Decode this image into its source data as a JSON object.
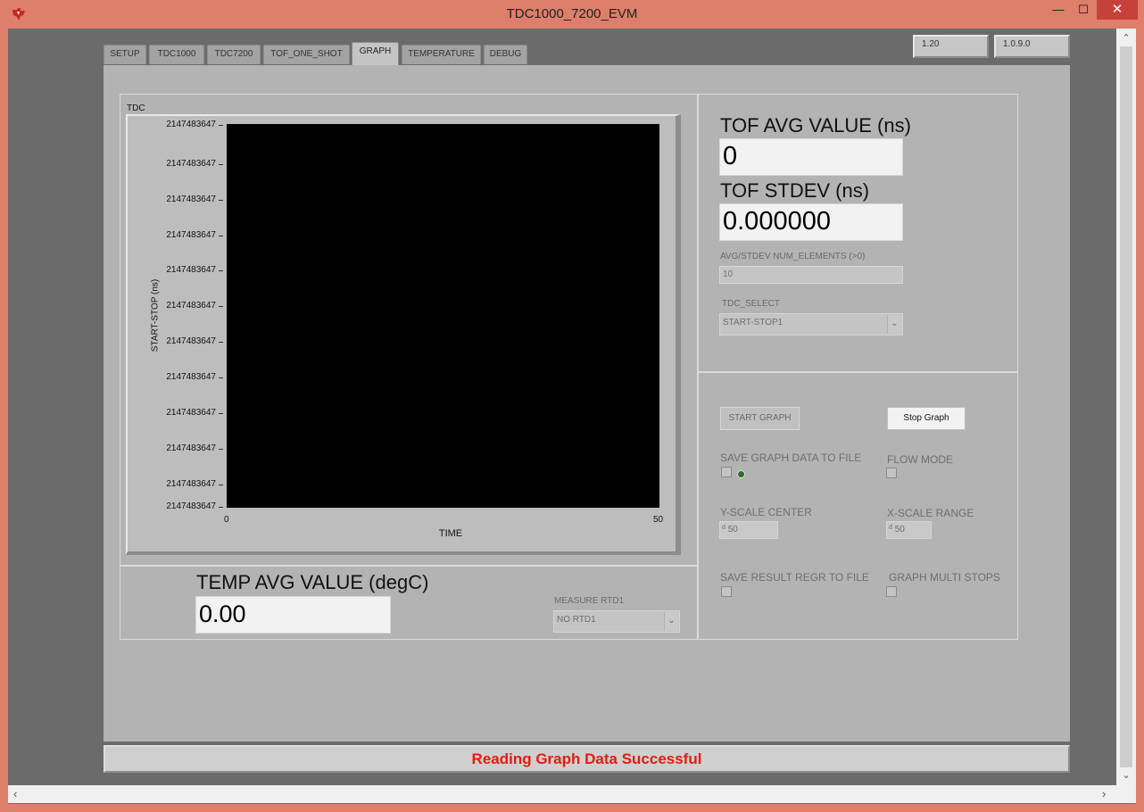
{
  "window": {
    "title": "TDC1000_7200_EVM"
  },
  "tabs": [
    {
      "label": "SETUP"
    },
    {
      "label": "TDC1000"
    },
    {
      "label": "TDC7200"
    },
    {
      "label": "TOF_ONE_SHOT"
    },
    {
      "label": "GRAPH",
      "active": true
    },
    {
      "label": "TEMPERATURE"
    },
    {
      "label": "DEBUG"
    }
  ],
  "versions": {
    "firmware": "1.20",
    "software": "1.0.9.0"
  },
  "graph": {
    "title": "TDC",
    "y_label": "START-STOP (ns)",
    "x_label": "TIME",
    "y_ticks": [
      "2147483647",
      "2147483647",
      "2147483647",
      "2147483647",
      "2147483647",
      "2147483647",
      "2147483647",
      "2147483647",
      "2147483647",
      "2147483647",
      "2147483647",
      "2147483647"
    ],
    "x_ticks": [
      "0",
      "50"
    ]
  },
  "chart_data": {
    "type": "line",
    "title": "TDC",
    "xlabel": "TIME",
    "ylabel": "START-STOP (ns)",
    "xlim": [
      0,
      50
    ],
    "series": []
  },
  "tof": {
    "avg_label": "TOF AVG VALUE (ns)",
    "avg_value": "0",
    "stdev_label": "TOF STDEV (ns)",
    "stdev_value": "0.000000",
    "num_elements_label": "AVG/STDEV NUM_ELEMENTS (>0)",
    "num_elements_value": "10",
    "tdc_select_label": "TDC_SELECT",
    "tdc_select_value": "START-STOP1"
  },
  "temp": {
    "avg_label": "TEMP AVG VALUE (degC)",
    "avg_value": "0.00",
    "measure_label": "MEASURE RTD1",
    "measure_value": "NO RTD1"
  },
  "controls": {
    "start_graph": "START GRAPH",
    "stop_graph": "Stop Graph",
    "save_graph_label": "SAVE GRAPH DATA TO FILE",
    "flow_mode_label": "FLOW MODE",
    "y_scale_center_label": "Y-SCALE CENTER",
    "y_scale_center_prefix": "d",
    "y_scale_center_value": "50",
    "x_scale_range_label": "X-SCALE RANGE",
    "x_scale_range_prefix": "d",
    "x_scale_range_value": "50",
    "save_result_label": "SAVE RESULT REGR TO FILE",
    "graph_multi_label": "GRAPH MULTI STOPS"
  },
  "status": {
    "message": "Reading Graph Data Successful"
  },
  "colors": {
    "status_text": "#e11d0f",
    "title_bar": "#dd7f6a",
    "plot_bg": "#000000"
  }
}
